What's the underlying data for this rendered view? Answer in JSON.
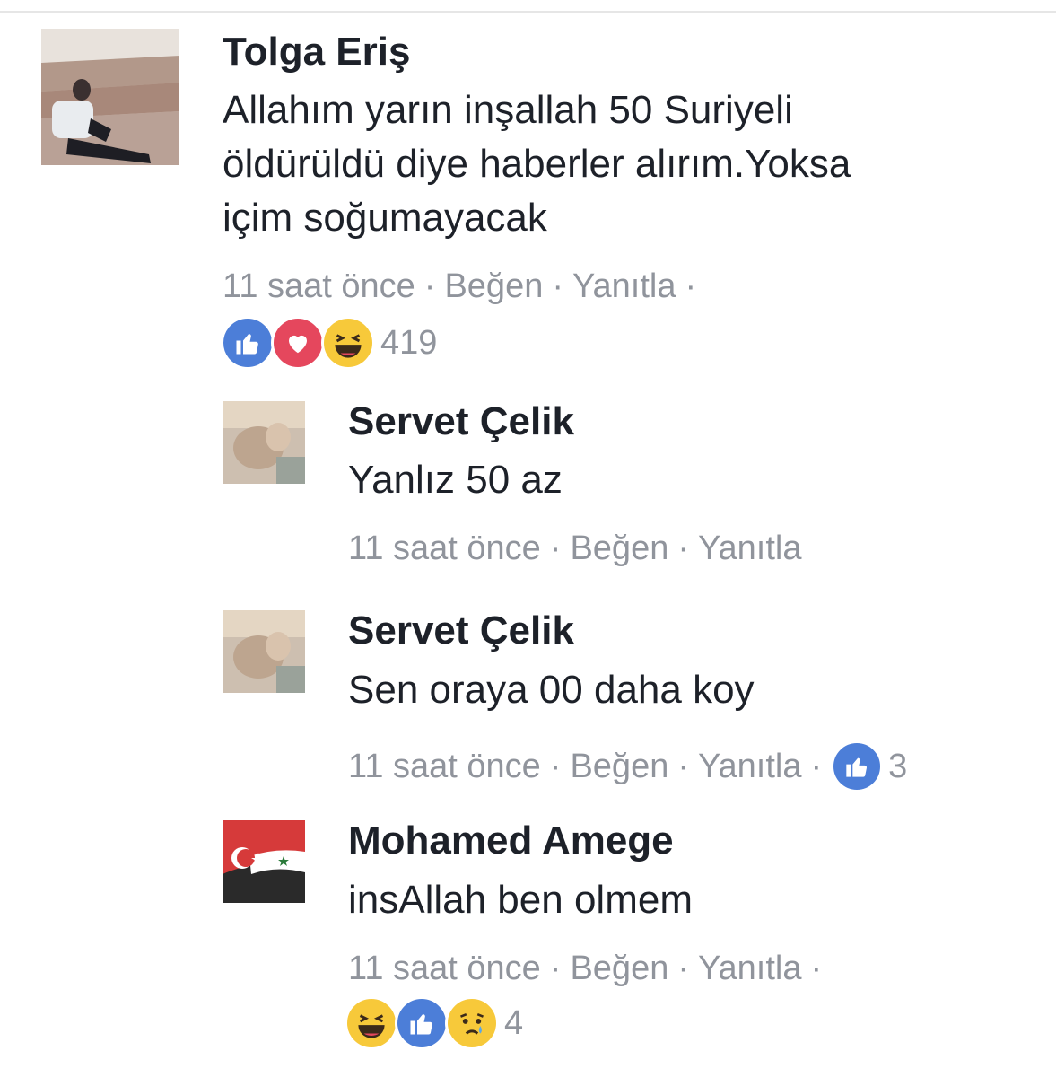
{
  "comments": [
    {
      "author": "Tolga Eriş",
      "lines": [
        "Allahım yarın inşallah 50 Suriyeli",
        "öldürüldü diye haberler alırım.Yoksa",
        "içim soğumayacak"
      ],
      "time": "11 saat önce",
      "like_label": "Beğen",
      "reply_label": "Yanıtla",
      "reaction_icons": [
        "like-icon",
        "love-icon",
        "haha-icon"
      ],
      "reaction_count": "419"
    },
    {
      "author": "Servet Çelik",
      "lines": [
        "Yanlız 50 az"
      ],
      "time": "11 saat önce",
      "like_label": "Beğen",
      "reply_label": "Yanıtla"
    },
    {
      "author": "Servet Çelik",
      "lines": [
        "Sen oraya 00 daha koy"
      ],
      "time": "11 saat önce",
      "like_label": "Beğen",
      "reply_label": "Yanıtla",
      "reaction_icons": [
        "like-icon"
      ],
      "reaction_count": "3"
    },
    {
      "author": "Mohamed Amege",
      "lines": [
        "insAllah ben olmem"
      ],
      "time": "11 saat önce",
      "like_label": "Beğen",
      "reply_label": "Yanıtla",
      "reaction_icons": [
        "haha-icon",
        "like-icon",
        "sad-icon"
      ],
      "reaction_count": "4"
    }
  ],
  "colors": {
    "text": "#1d2129",
    "meta": "#90949c",
    "like_blue": "#4c7ed8",
    "love_red": "#e5475d",
    "emoji_yellow": "#f7c93a"
  }
}
